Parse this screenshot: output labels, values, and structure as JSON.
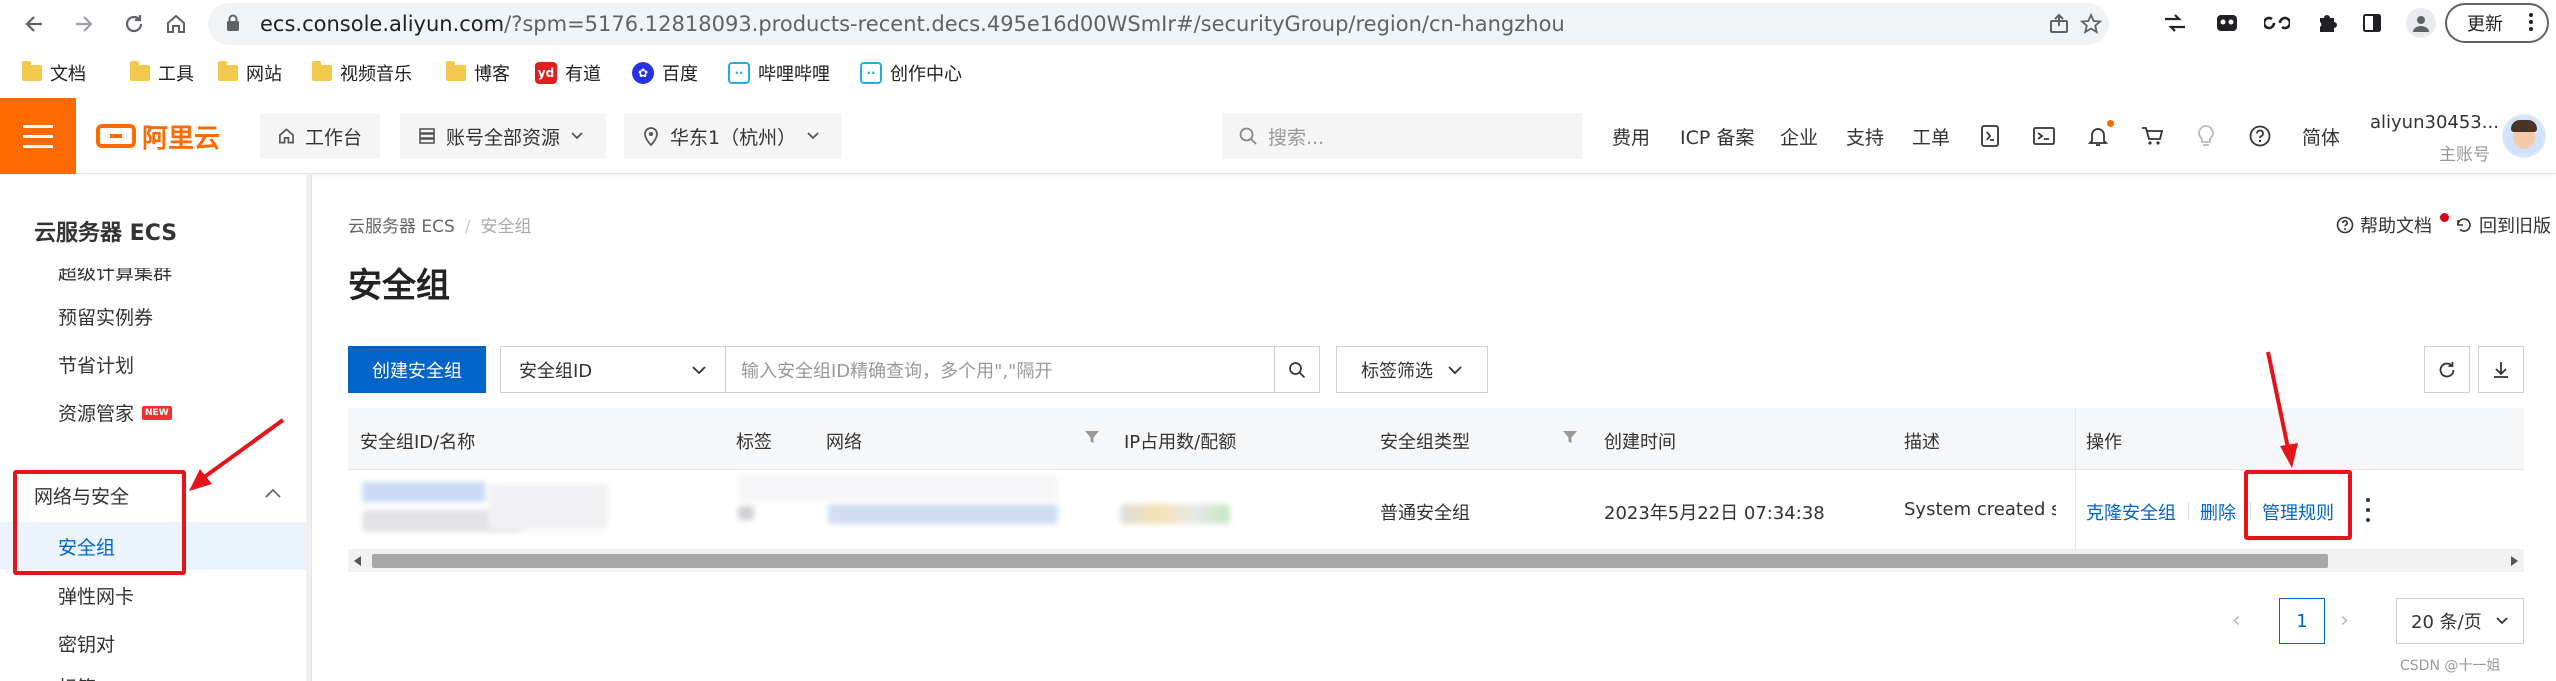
{
  "browser": {
    "url_domain": "ecs.console.aliyun.com",
    "url_path": "/?spm=5176.12818093.products-recent.decs.495e16d00WSmIr#/securityGroup/region/cn-hangzhou",
    "update_label": "更新",
    "bookmarks": [
      {
        "label": "文档",
        "icon": "folder-icon"
      },
      {
        "label": "工具",
        "icon": "folder-icon"
      },
      {
        "label": "网站",
        "icon": "folder-icon"
      },
      {
        "label": "视频音乐",
        "icon": "folder-icon"
      },
      {
        "label": "博客",
        "icon": "folder-icon"
      },
      {
        "label": "有道",
        "icon": "youdao-icon"
      },
      {
        "label": "百度",
        "icon": "baidu-icon"
      },
      {
        "label": "哔哩哔哩",
        "icon": "bilibili-icon"
      },
      {
        "label": "创作中心",
        "icon": "bilibili-icon"
      }
    ]
  },
  "topbar": {
    "logo_text": "阿里云",
    "workbench": "工作台",
    "resources": "账号全部资源",
    "region": "华东1（杭州）",
    "search_placeholder": "搜索...",
    "links": [
      "费用",
      "ICP 备案",
      "企业",
      "支持",
      "工单"
    ],
    "lang": "简体",
    "user_name": "aliyun30453...",
    "user_role": "主账号",
    "brand_color": "#ff6a00"
  },
  "sidebar": {
    "title": "云服务器 ECS",
    "items_top": [
      {
        "label": "超级计算集群",
        "badge": ""
      },
      {
        "label": "预留实例券",
        "badge": ""
      },
      {
        "label": "节省计划",
        "badge": ""
      },
      {
        "label": "资源管家",
        "badge": "NEW"
      }
    ],
    "group": "网络与安全",
    "active_item": "安全组",
    "items_bottom": [
      "弹性网卡",
      "密钥对",
      "标签"
    ]
  },
  "main": {
    "breadcrumb": [
      "云服务器 ECS",
      "安全组"
    ],
    "help_doc": "帮助文档",
    "back_old": "回到旧版",
    "title": "安全组",
    "create_btn": "创建安全组",
    "filter_select": "安全组ID",
    "search_placeholder": "输入安全组ID精确查询，多个用\",\"隔开",
    "tag_filter": "标签筛选",
    "accent_color": "#0064c8"
  },
  "table": {
    "headers": [
      "安全组ID/名称",
      "标签",
      "网络",
      "IP占用数/配额",
      "安全组类型",
      "创建时间",
      "描述",
      "操作"
    ],
    "rows": [
      {
        "type": "普通安全组",
        "created": "2023年5月22日 07:34:38",
        "desc": "System created security group.",
        "actions": [
          "克隆安全组",
          "删除",
          "管理规则"
        ]
      }
    ]
  },
  "pagination": {
    "current": "1",
    "page_size": "20 条/页"
  },
  "watermark": "CSDN @十一姐"
}
